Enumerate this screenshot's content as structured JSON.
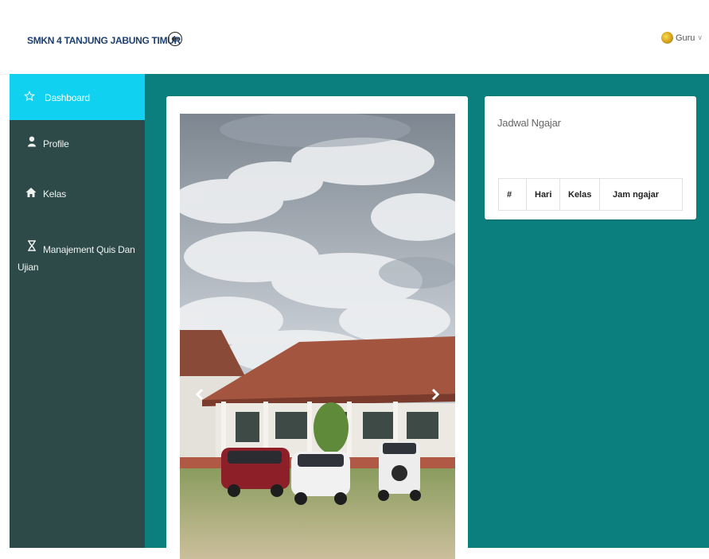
{
  "header": {
    "brand": "SMKN 4 TANJUNG JABUNG TIMUR",
    "back_icon": "arrow-left-circle-icon",
    "user": {
      "name": "Guru",
      "avatar_icon": "user-avatar"
    }
  },
  "sidebar": {
    "items": [
      {
        "label": "Dashboard",
        "icon": "star-icon",
        "active": true
      },
      {
        "label": "Profile",
        "icon": "user-icon",
        "active": false
      },
      {
        "label": "Kelas",
        "icon": "home-icon",
        "active": false
      },
      {
        "label": "Manajement Quis Dan Ujian",
        "icon": "hourglass-icon",
        "active": false
      }
    ]
  },
  "main": {
    "carousel": {
      "prev_icon": "chevron-left-icon",
      "next_icon": "chevron-right-icon"
    },
    "schedule": {
      "title": "Jadwal Ngajar",
      "columns": [
        "#",
        "Hari",
        "Kelas",
        "Jam ngajar"
      ]
    }
  },
  "colors": {
    "sidebar": "#2e4a48",
    "active": "#10d1ef",
    "content_bg": "#0b7f7e",
    "brand_text": "#1d3f72"
  }
}
